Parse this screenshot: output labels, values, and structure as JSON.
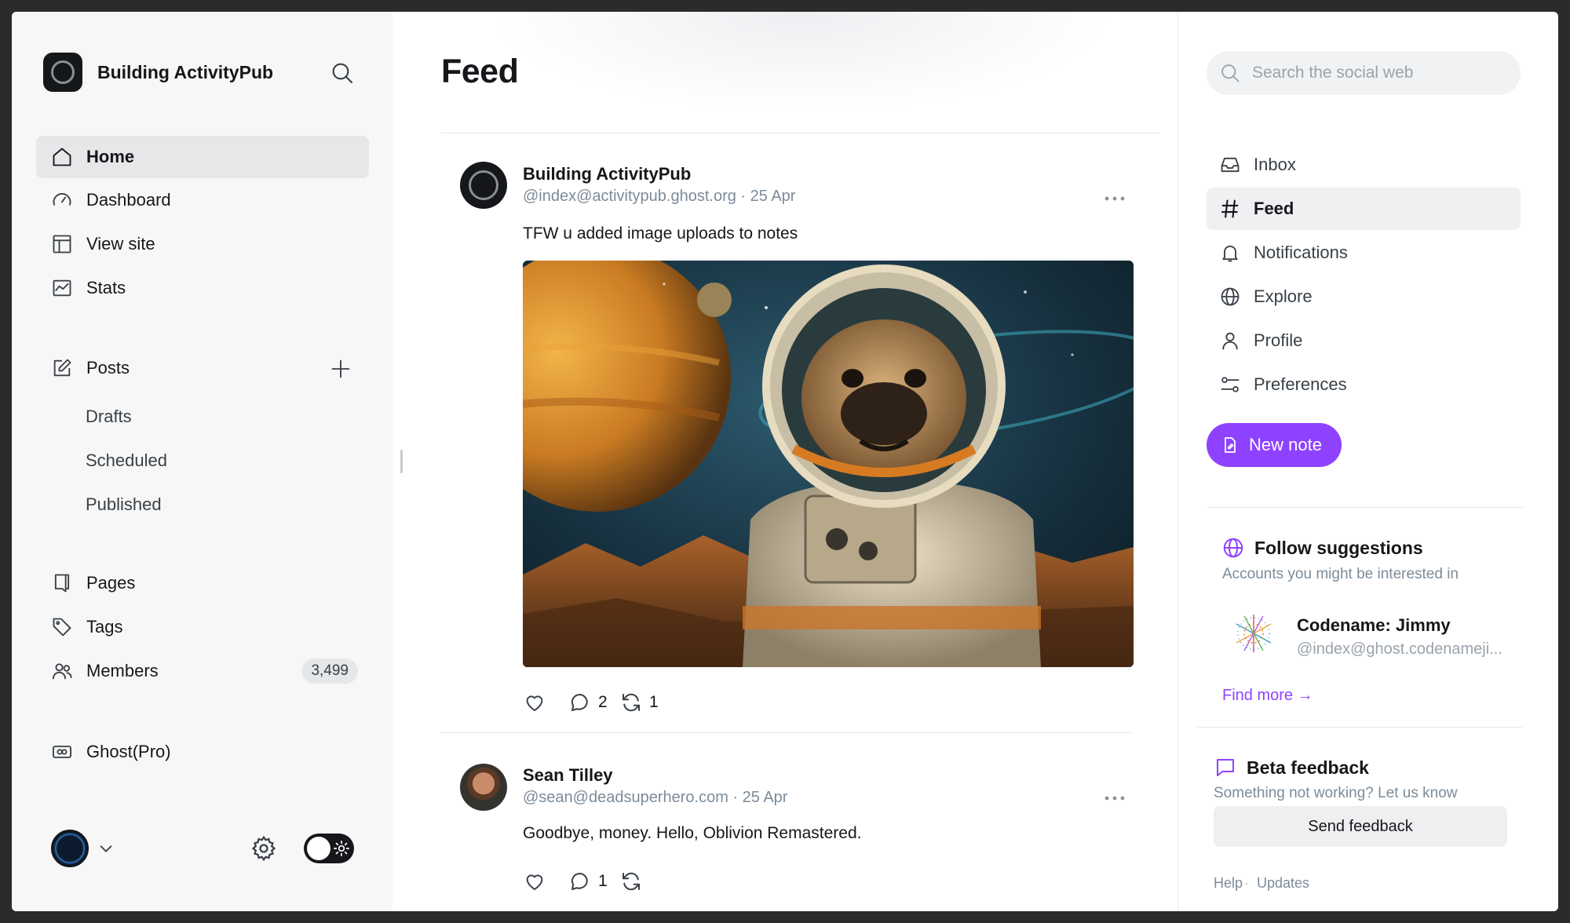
{
  "sidebar": {
    "brand": "Building ActivityPub",
    "nav": [
      {
        "label": "Home"
      },
      {
        "label": "Dashboard"
      },
      {
        "label": "View site"
      },
      {
        "label": "Stats"
      }
    ],
    "posts_label": "Posts",
    "posts_sub": [
      "Drafts",
      "Scheduled",
      "Published"
    ],
    "pages_label": "Pages",
    "tags_label": "Tags",
    "members_label": "Members",
    "members_count": "3,499",
    "ghostpro_label": "Ghost(Pro)"
  },
  "feed": {
    "title": "Feed",
    "posts": [
      {
        "author": "Building ActivityPub",
        "handle": "@index@activitypub.ghost.org · 25 Apr",
        "text": "TFW u added image uploads to notes",
        "replies": "2",
        "reposts": "1"
      },
      {
        "author": "Sean Tilley",
        "handle": "@sean@deadsuperhero.com · 25 Apr",
        "text": "Goodbye, money. Hello, Oblivion Remastered.",
        "replies": "1",
        "reposts": ""
      }
    ]
  },
  "right": {
    "search_placeholder": "Search the social web",
    "nav": [
      {
        "label": "Inbox"
      },
      {
        "label": "Feed"
      },
      {
        "label": "Notifications"
      },
      {
        "label": "Explore"
      },
      {
        "label": "Profile"
      },
      {
        "label": "Preferences"
      }
    ],
    "new_note": "New note",
    "follow": {
      "title": "Follow suggestions",
      "subtitle": "Accounts you might be interested in",
      "name": "Codename: Jimmy",
      "handle": "@index@ghost.codenameji...",
      "find_more": "Find more →"
    },
    "beta": {
      "title": "Beta feedback",
      "subtitle": "Something not working? Let us know",
      "button": "Send feedback"
    },
    "footer": [
      "Help",
      "Updates"
    ],
    "footer_sep": "·"
  },
  "colors": {
    "accent": "#8e42ff",
    "sidebar_bg": "#f7f7f7",
    "text": "#15171a"
  }
}
